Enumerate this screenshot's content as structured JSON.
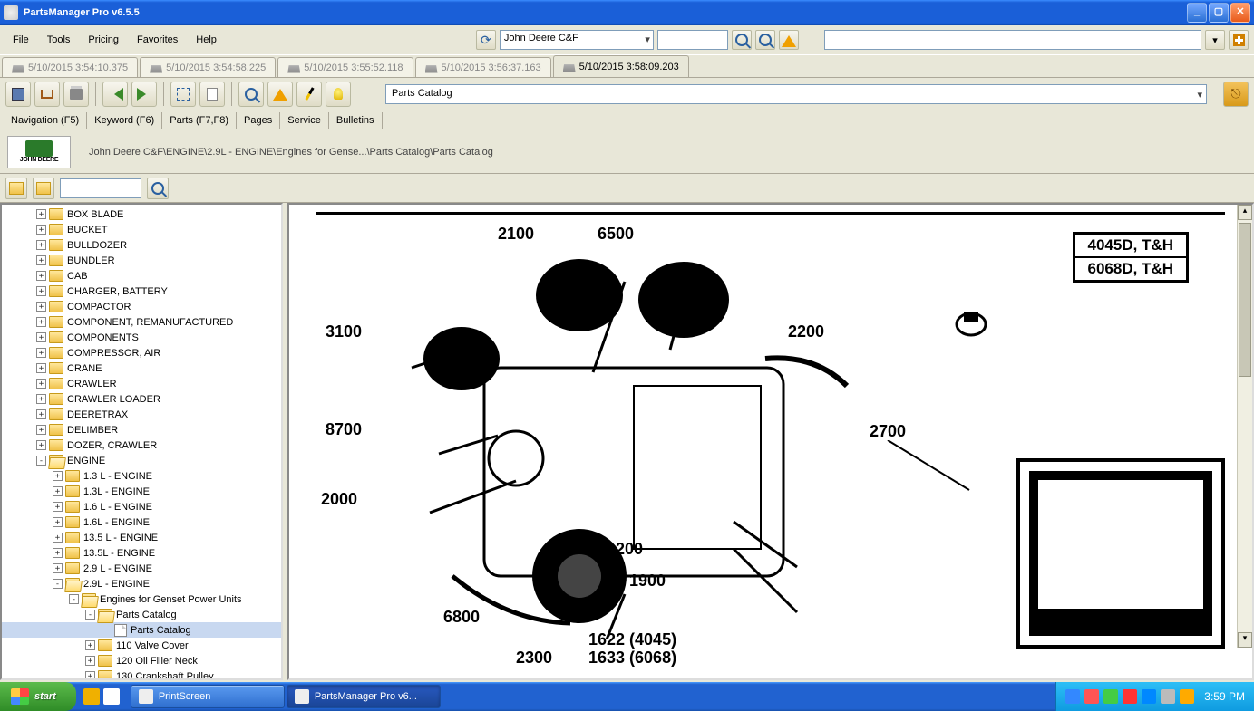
{
  "app": {
    "title": "PartsManager Pro v6.5.5"
  },
  "menu": {
    "items": [
      "File",
      "Tools",
      "Pricing",
      "Favorites",
      "Help"
    ]
  },
  "topbar": {
    "brand_combo": "John Deere C&F",
    "search_placeholder": ""
  },
  "session_tabs": [
    {
      "label": "5/10/2015 3:54:10.375",
      "active": false
    },
    {
      "label": "5/10/2015 3:54:58.225",
      "active": false
    },
    {
      "label": "5/10/2015 3:55:52.118",
      "active": false
    },
    {
      "label": "5/10/2015 3:56:37.163",
      "active": false
    },
    {
      "label": "5/10/2015 3:58:09.203",
      "active": true
    }
  ],
  "catalog_combo": "Parts Catalog",
  "subtabs": [
    "Navigation (F5)",
    "Keyword (F6)",
    "Parts (F7,F8)",
    "Pages",
    "Service",
    "Bulletins"
  ],
  "brand_logo_text": "JOHN DEERE",
  "breadcrumb": "John Deere C&F\\ENGINE\\2.9L - ENGINE\\Engines for Gense...\\Parts Catalog\\Parts Catalog",
  "tree": [
    {
      "d": 1,
      "exp": "+",
      "icon": "folder",
      "label": "BOX BLADE"
    },
    {
      "d": 1,
      "exp": "+",
      "icon": "folder",
      "label": "BUCKET"
    },
    {
      "d": 1,
      "exp": "+",
      "icon": "folder",
      "label": "BULLDOZER"
    },
    {
      "d": 1,
      "exp": "+",
      "icon": "folder",
      "label": "BUNDLER"
    },
    {
      "d": 1,
      "exp": "+",
      "icon": "folder",
      "label": "CAB"
    },
    {
      "d": 1,
      "exp": "+",
      "icon": "folder",
      "label": "CHARGER, BATTERY"
    },
    {
      "d": 1,
      "exp": "+",
      "icon": "folder",
      "label": "COMPACTOR"
    },
    {
      "d": 1,
      "exp": "+",
      "icon": "folder",
      "label": "COMPONENT, REMANUFACTURED"
    },
    {
      "d": 1,
      "exp": "+",
      "icon": "folder",
      "label": "COMPONENTS"
    },
    {
      "d": 1,
      "exp": "+",
      "icon": "folder",
      "label": "COMPRESSOR, AIR"
    },
    {
      "d": 1,
      "exp": "+",
      "icon": "folder",
      "label": "CRANE"
    },
    {
      "d": 1,
      "exp": "+",
      "icon": "folder",
      "label": "CRAWLER"
    },
    {
      "d": 1,
      "exp": "+",
      "icon": "folder",
      "label": "CRAWLER LOADER"
    },
    {
      "d": 1,
      "exp": "+",
      "icon": "folder",
      "label": "DEERETRAX"
    },
    {
      "d": 1,
      "exp": "+",
      "icon": "folder",
      "label": "DELIMBER"
    },
    {
      "d": 1,
      "exp": "+",
      "icon": "folder",
      "label": "DOZER, CRAWLER"
    },
    {
      "d": 1,
      "exp": "-",
      "icon": "folder-open",
      "label": "ENGINE"
    },
    {
      "d": 2,
      "exp": "+",
      "icon": "folder",
      "label": "1.3 L - ENGINE"
    },
    {
      "d": 2,
      "exp": "+",
      "icon": "folder",
      "label": "1.3L - ENGINE"
    },
    {
      "d": 2,
      "exp": "+",
      "icon": "folder",
      "label": "1.6 L - ENGINE"
    },
    {
      "d": 2,
      "exp": "+",
      "icon": "folder",
      "label": "1.6L - ENGINE"
    },
    {
      "d": 2,
      "exp": "+",
      "icon": "folder",
      "label": "13.5 L - ENGINE"
    },
    {
      "d": 2,
      "exp": "+",
      "icon": "folder",
      "label": "13.5L - ENGINE"
    },
    {
      "d": 2,
      "exp": "+",
      "icon": "folder",
      "label": "2.9 L - ENGINE"
    },
    {
      "d": 2,
      "exp": "-",
      "icon": "folder-open",
      "label": "2.9L - ENGINE"
    },
    {
      "d": 3,
      "exp": "-",
      "icon": "folder-open",
      "label": "Engines for Genset Power Units"
    },
    {
      "d": 4,
      "exp": "-",
      "icon": "folder-open",
      "label": "Parts Catalog"
    },
    {
      "d": 5,
      "exp": "",
      "icon": "doc",
      "label": "Parts Catalog",
      "selected": true
    },
    {
      "d": 4,
      "exp": "+",
      "icon": "folder",
      "label": "110 Valve Cover"
    },
    {
      "d": 4,
      "exp": "+",
      "icon": "folder",
      "label": "120 Oil Filler Neck"
    },
    {
      "d": 4,
      "exp": "+",
      "icon": "folder",
      "label": "130 Crankshaft Pulley"
    }
  ],
  "diagram": {
    "models": [
      "4045D, T&H",
      "6068D, T&H"
    ],
    "callouts": {
      "c2100": "2100",
      "c6500": "6500",
      "c3100": "3100",
      "c2200": "2200",
      "c8700": "8700",
      "c2000": "2000",
      "c1200": "1200",
      "c6800": "6800",
      "c1900": "1900",
      "c2300": "2300",
      "c2700": "2700",
      "c1622": "1622 (4045)",
      "c1633": "1633 (6068)"
    }
  },
  "taskbar": {
    "start": "start",
    "tasks": [
      {
        "label": "PrintScreen",
        "active": false
      },
      {
        "label": "PartsManager Pro v6...",
        "active": true
      }
    ],
    "clock": "3:59 PM"
  }
}
